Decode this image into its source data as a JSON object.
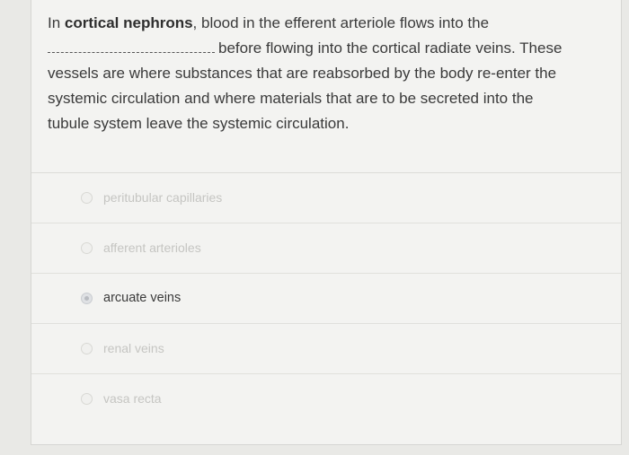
{
  "question": {
    "prefix": "In ",
    "bold_term": "cortical nephrons",
    "line1_rest": ", blood in the efferent arteriole flows into the",
    "line2_rest": "before flowing into the cortical radiate veins. These",
    "line3": "vessels are where substances that are reabsorbed by the body re-enter the",
    "line4": "systemic circulation and where materials that are to be secreted into the",
    "line5": "tubule system leave the systemic circulation."
  },
  "options": [
    {
      "label": "peritubular capillaries",
      "selected": false
    },
    {
      "label": "afferent arterioles",
      "selected": false
    },
    {
      "label": "arcuate veins",
      "selected": true
    },
    {
      "label": "renal veins",
      "selected": false
    },
    {
      "label": "vasa recta",
      "selected": false
    }
  ],
  "colors": {
    "background": "#e9e9e6",
    "card": "#f3f3f1",
    "text": "#3a3a3a",
    "faded_text": "#c5c5c2"
  }
}
